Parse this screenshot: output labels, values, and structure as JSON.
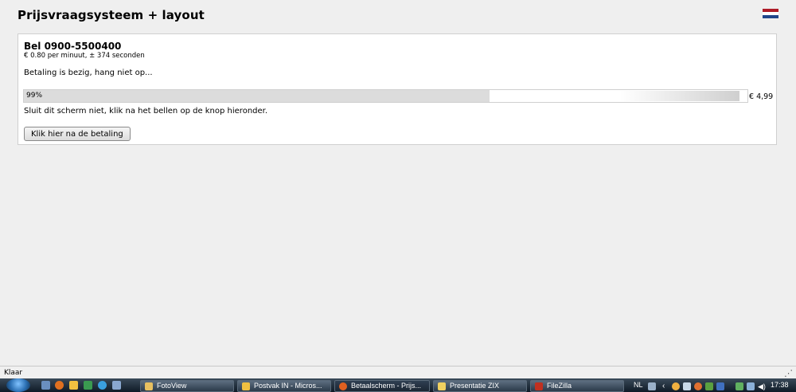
{
  "page": {
    "title": "Prijsvraagsysteem + layout"
  },
  "colors": {
    "flag_red": "#ae1c28",
    "flag_white": "#ffffff",
    "flag_blue": "#21468b",
    "progress_fill": "#dcdcdc"
  },
  "payment": {
    "phone_label": "Bel 0900-5500400",
    "rate_label": "€ 0.80 per minuut, ± 374 seconden",
    "status_text": "Betaling is bezig, hang niet op...",
    "progress": {
      "percent": 99,
      "label": "99%"
    },
    "price": "€ 4,99",
    "note": "Sluit dit scherm niet, klik na het bellen op de knop hieronder.",
    "button_label": "Klik hier na de betaling"
  },
  "browser_status": {
    "text": "Klaar",
    "grip_icon": "resize-grip-icon"
  },
  "taskbar": {
    "items": [
      {
        "label": "FotoView",
        "icon": "folder-icon",
        "color": "#e8c060"
      },
      {
        "label": "Postvak IN - Micros...",
        "icon": "outlook-icon",
        "color": "#f0c040"
      },
      {
        "label": "Betaalscherm - Prijs...",
        "icon": "firefox-icon",
        "color": "#e06020"
      },
      {
        "label": "Presentatie ZIX",
        "icon": "document-icon",
        "color": "#f0d060"
      },
      {
        "label": "FileZilla",
        "icon": "filezilla-icon",
        "color": "#c03020"
      }
    ],
    "tray_lang": "NL",
    "clock": "17:38"
  }
}
